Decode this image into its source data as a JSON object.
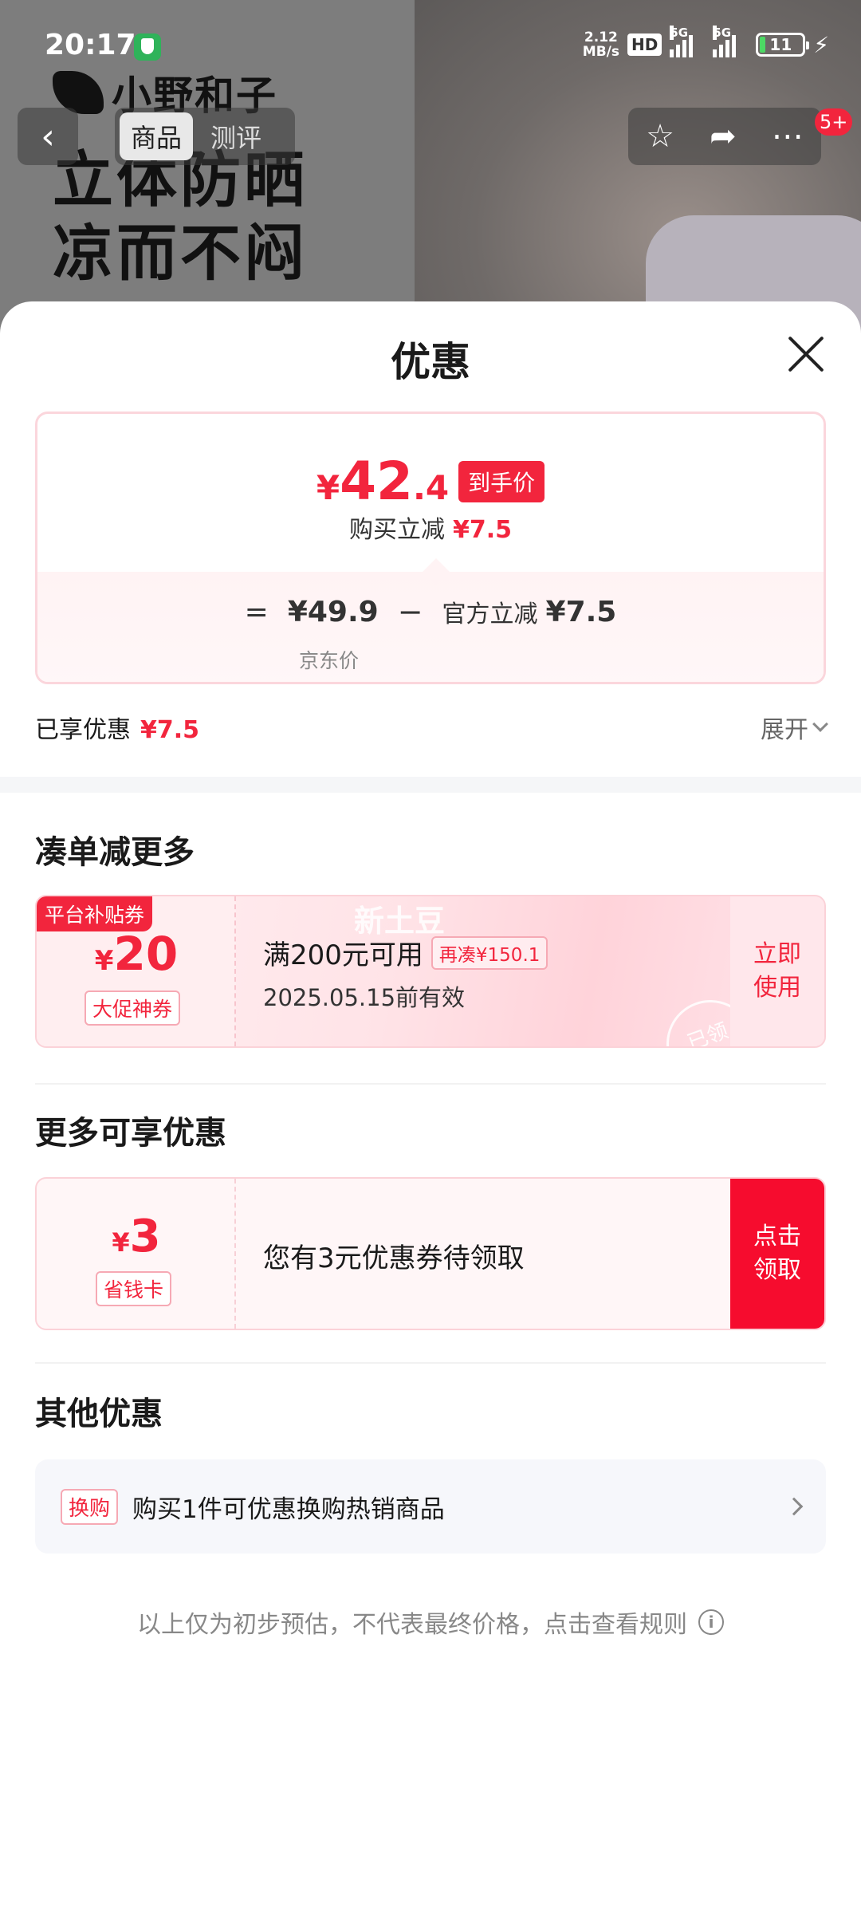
{
  "status_bar": {
    "time": "20:17",
    "net_speed_top": "2.12",
    "net_speed_unit": "MB/s",
    "hd": "HD",
    "signal1": "5G",
    "signal2": "5G",
    "battery": "11"
  },
  "background": {
    "brand": "小野和子",
    "slogan_line1": "立体防晒",
    "slogan_line2": "凉而不闷"
  },
  "nav": {
    "tabs": [
      {
        "label": "商品",
        "active": true
      },
      {
        "label": "测评",
        "active": false
      }
    ],
    "message_badge": "5+"
  },
  "sheet": {
    "title": "优惠",
    "price_card": {
      "yen": "¥",
      "price_int": "42",
      "price_dec": ".4",
      "final_badge": "到手价",
      "instant_label": "购买立减",
      "instant_amount": "¥7.5",
      "equals": "=",
      "jd_price": "¥49.9",
      "minus": "−",
      "official_label": "官方立减",
      "official_amount": "¥7.5",
      "jd_label": "京东价"
    },
    "enjoyed": {
      "label": "已享优惠",
      "amount": "¥7.5",
      "expand": "展开"
    },
    "section_combine": {
      "title": "凑单减更多",
      "coupon": {
        "tag": "平台补贴券",
        "yen": "¥",
        "amount": "20",
        "type": "大促神券",
        "watermark": "新土豆",
        "condition": "满200元可用",
        "more": "再凑¥150.1",
        "expiry": "2025.05.15前有效",
        "stamp": "已领",
        "button": "立即使用"
      }
    },
    "section_more": {
      "title": "更多可享优惠",
      "coupon": {
        "yen": "¥",
        "amount": "3",
        "type": "省钱卡",
        "text": "您有3元优惠券待领取",
        "button": "点击领取"
      }
    },
    "section_other": {
      "title": "其他优惠",
      "tag": "换购",
      "text": "购买1件可优惠换购热销商品"
    },
    "disclaimer": "以上仅为初步预估，不代表最终价格，点击查看规则"
  },
  "colors": {
    "accent_red": "#f2253d",
    "button_red": "#f60c2e"
  }
}
